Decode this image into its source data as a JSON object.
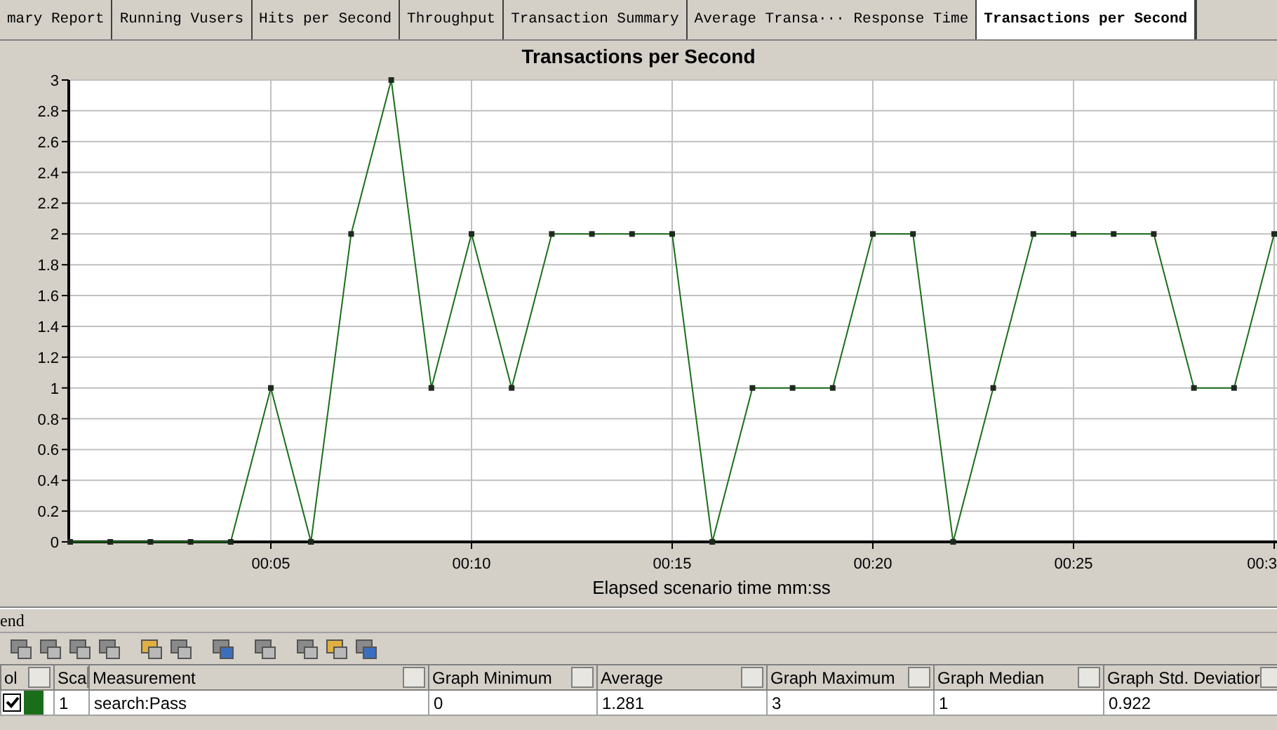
{
  "tabs": [
    {
      "label": "mary Report",
      "selected": false
    },
    {
      "label": "Running Vusers",
      "selected": false
    },
    {
      "label": "Hits per Second",
      "selected": false
    },
    {
      "label": "Throughput",
      "selected": false
    },
    {
      "label": "Transaction Summary",
      "selected": false
    },
    {
      "label": "Average Transa··· Response Time",
      "selected": false
    },
    {
      "label": "Transactions per Second",
      "selected": true
    }
  ],
  "chart": {
    "chart_data": {
      "type": "line",
      "title": "Transactions per Second",
      "xlabel": "Elapsed scenario time mm:ss",
      "x": [
        0,
        1,
        2,
        3,
        4,
        5,
        6,
        7,
        8,
        9,
        10,
        11,
        12,
        13,
        14,
        15,
        16,
        17,
        18,
        19,
        20,
        21,
        22,
        23,
        24,
        25,
        26,
        27,
        28,
        29,
        30
      ],
      "grid": true,
      "series": [
        {
          "color": "#1a6e1a",
          "marker": "square",
          "values": [
            0,
            0,
            0,
            0,
            0,
            1,
            0,
            2,
            3,
            1,
            2,
            1,
            2,
            2,
            2,
            2,
            0,
            1,
            1,
            1,
            2,
            2,
            0,
            1,
            2,
            2,
            2,
            2,
            1,
            1,
            2
          ]
        }
      ],
      "xlim": [
        0,
        30
      ],
      "ylim": [
        0,
        3
      ],
      "xticks": [
        {
          "value": 5,
          "label": "00:05"
        },
        {
          "value": 10,
          "label": "00:10"
        },
        {
          "value": 15,
          "label": "00:15"
        },
        {
          "value": 20,
          "label": "00:20"
        },
        {
          "value": 25,
          "label": "00:25"
        },
        {
          "value": 30,
          "label": "00:3"
        }
      ],
      "yticks": [
        {
          "value": 0,
          "label": "0"
        },
        {
          "value": 0.2,
          "label": "0.2"
        },
        {
          "value": 0.4,
          "label": "0.4"
        },
        {
          "value": 0.6,
          "label": "0.6"
        },
        {
          "value": 0.8,
          "label": "0.8"
        },
        {
          "value": 1,
          "label": "1"
        },
        {
          "value": 1.2,
          "label": "1.2"
        },
        {
          "value": 1.4,
          "label": "1.4"
        },
        {
          "value": 1.6,
          "label": "1.6"
        },
        {
          "value": 1.8,
          "label": "1.8"
        },
        {
          "value": 2,
          "label": "2"
        },
        {
          "value": 2.2,
          "label": "2.2"
        },
        {
          "value": 2.4,
          "label": "2.4"
        },
        {
          "value": 2.6,
          "label": "2.6"
        },
        {
          "value": 2.8,
          "label": "2.8"
        },
        {
          "value": 3,
          "label": "3"
        }
      ]
    }
  },
  "legend": {
    "title": "end",
    "columns": [
      "ol",
      "Sca",
      "Measurement",
      "Graph Minimum",
      "Average",
      "Graph Maximum",
      "Graph Median",
      "Graph Std. Deviatior"
    ],
    "rows": [
      {
        "checked": true,
        "color": "#1a6e1a",
        "cells": [
          "",
          "1",
          "search:Pass",
          "0",
          "1.281",
          "3",
          "1",
          "0.922"
        ]
      }
    ]
  }
}
